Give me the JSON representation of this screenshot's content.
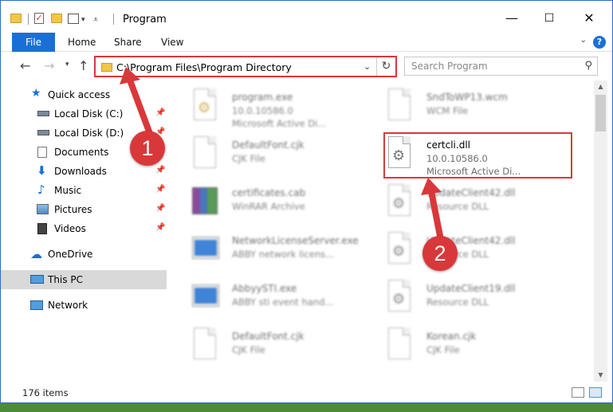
{
  "window": {
    "title": "Program",
    "min_symbol": "—",
    "max_symbol": "☐",
    "close_symbol": "✕"
  },
  "ribbon": {
    "tabs": [
      "File",
      "Home",
      "Share",
      "View"
    ],
    "help": "?"
  },
  "address": {
    "path": "C:\\Program Files\\Program Directory",
    "search_placeholder": "Search Program"
  },
  "sidebar": {
    "items": [
      {
        "label": "Quick access",
        "icon": "star-icon",
        "pinned": false
      },
      {
        "label": "Local Disk (C:)",
        "icon": "drive-icon",
        "pinned": true
      },
      {
        "label": "Local Disk (D:)",
        "icon": "drive-icon",
        "pinned": true
      },
      {
        "label": "Documents",
        "icon": "documents-icon",
        "pinned": true
      },
      {
        "label": "Downloads",
        "icon": "download-icon",
        "pinned": true
      },
      {
        "label": "Music",
        "icon": "music-icon",
        "pinned": true
      },
      {
        "label": "Pictures",
        "icon": "pictures-icon",
        "pinned": true
      },
      {
        "label": "Videos",
        "icon": "videos-icon",
        "pinned": true
      },
      {
        "label": "OneDrive",
        "icon": "cloud-icon",
        "pinned": false
      },
      {
        "label": "This PC",
        "icon": "computer-icon",
        "pinned": false,
        "selected": true
      },
      {
        "label": "Network",
        "icon": "network-icon",
        "pinned": false
      }
    ]
  },
  "files": {
    "left": [
      {
        "name": "program.exe",
        "line2": "10.0.10586.0",
        "line3": "Microsoft Active Di...",
        "icon": "installer-icon"
      },
      {
        "name": "DefaultFont.cjk",
        "line2": "CJK File",
        "icon": "blank-file-icon"
      },
      {
        "name": "certificates.cab",
        "line2": "WinRAR Archive",
        "icon": "winrar-icon"
      },
      {
        "name": "NetworkLicenseServer.exe",
        "line2": "ABBY network licens...",
        "icon": "exe-icon"
      },
      {
        "name": "AbbyySTI.exe",
        "line2": "ABBY sti event hand...",
        "icon": "exe-icon"
      },
      {
        "name": "DefaultFont.cjk",
        "line2": "CJK File",
        "icon": "blank-file-icon"
      }
    ],
    "right": [
      {
        "name": "SndToWP13.wcm",
        "line2": "WCM File",
        "icon": "blank-file-icon"
      },
      {
        "name": "certcli.dll",
        "line2": "10.0.10586.0",
        "line3": "Microsoft Active Di...",
        "icon": "dll-gear-icon"
      },
      {
        "name": "UpdateClient42.dll",
        "line2": "Resource DLL",
        "icon": "dll-gear-icon"
      },
      {
        "name": "UpdateClient42.dll",
        "line2": "Resource DLL",
        "icon": "dll-gear-icon"
      },
      {
        "name": "UpdateClient19.dll",
        "line2": "Resource DLL",
        "icon": "dll-gear-icon"
      },
      {
        "name": "Korean.cjk",
        "line2": "CJK File",
        "icon": "blank-file-icon"
      }
    ]
  },
  "status": {
    "count": "176 items"
  },
  "callouts": {
    "one": "1",
    "two": "2"
  },
  "colors": {
    "accent": "#1a6fd6",
    "highlight": "#d9383a",
    "selected_bg": "#d9d9d9"
  }
}
